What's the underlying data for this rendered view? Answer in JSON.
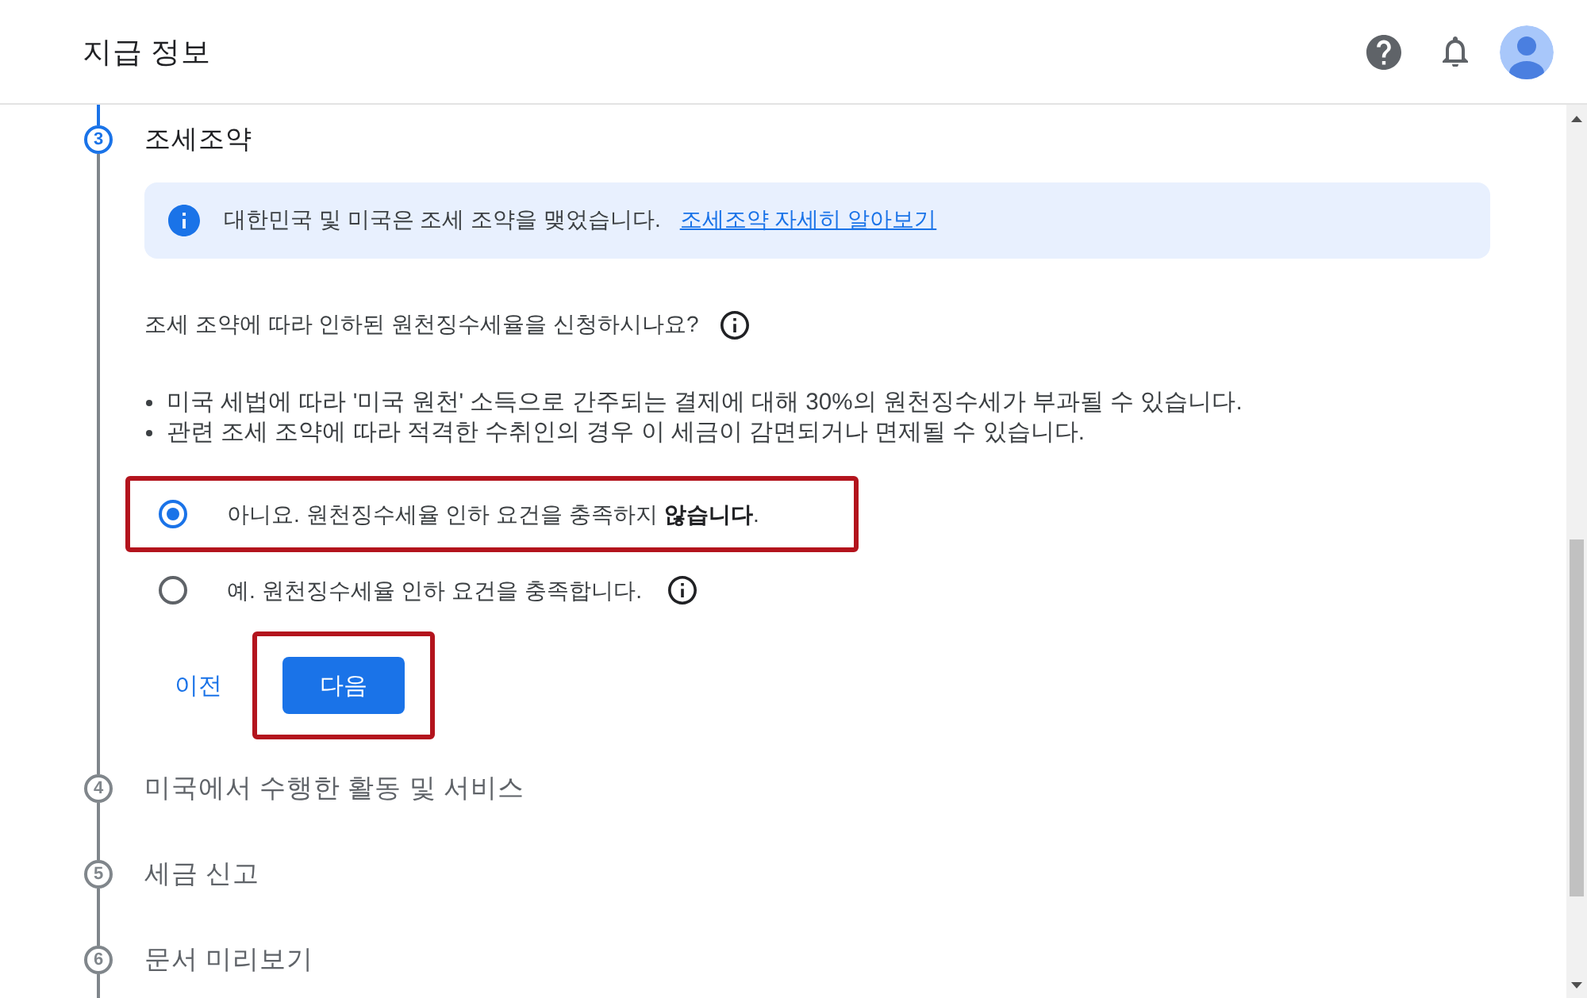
{
  "header": {
    "title": "지급 정보"
  },
  "steps": [
    {
      "number": "3",
      "title": "조세조약",
      "active": true,
      "content": {
        "notice": {
          "text": "대한민국 및 미국은 조세 조약을 맺었습니다.",
          "link": "조세조약 자세히 알아보기"
        },
        "question": "조세 조약에 따라 인하된 원천징수세율을 신청하시나요?",
        "bullets": [
          "미국 세법에 따라 '미국 원천' 소득으로 간주되는 결제에 대해 30%의 원천징수세가 부과될 수 있습니다.",
          "관련 조세 조약에 따라 적격한 수취인의 경우 이 세금이 감면되거나 면제될 수 있습니다."
        ],
        "options": [
          {
            "label": "아니요. 원천징수세율 인하 요건을 충족하지 **않습니다**.",
            "selected": true,
            "highlighted": true,
            "has_info": false
          },
          {
            "label": "예. 원천징수세율 인하 요건을 충족합니다.",
            "selected": false,
            "highlighted": false,
            "has_info": true
          }
        ],
        "buttons": [
          {
            "label": "이전",
            "kind": "text",
            "highlighted": false
          },
          {
            "label": "다음",
            "kind": "primary",
            "highlighted": true
          }
        ]
      }
    },
    {
      "number": "4",
      "title": "미국에서 수행한 활동 및 서비스",
      "active": false
    },
    {
      "number": "5",
      "title": "세금 신고",
      "active": false
    },
    {
      "number": "6",
      "title": "문서 미리보기",
      "active": false
    }
  ]
}
